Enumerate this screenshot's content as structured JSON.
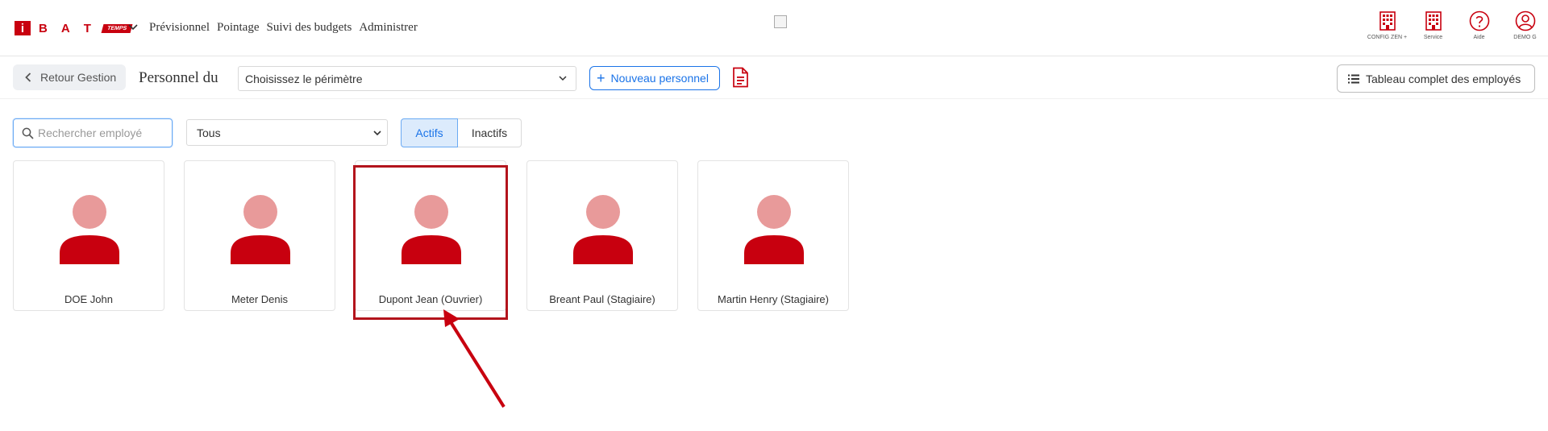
{
  "header": {
    "logo": {
      "mark": "i",
      "letters": [
        "B",
        "A",
        "T"
      ],
      "tag": "TEMPS"
    },
    "nav": [
      "Prévisionnel",
      "Pointage",
      "Suivi des budgets",
      "Administrer"
    ],
    "icons": [
      {
        "name": "building-icon",
        "label": "CONFIG ZEN +"
      },
      {
        "name": "building-icon",
        "label": "Service"
      },
      {
        "name": "help-icon",
        "label": "Aide"
      },
      {
        "name": "user-icon",
        "label": "DEMO G"
      }
    ]
  },
  "toolbar": {
    "back_label": "Retour Gestion",
    "title": "Personnel du",
    "perimeter_placeholder": "Choisissez le périmètre",
    "new_label": "Nouveau personnel",
    "table_label": "Tableau complet des employés"
  },
  "filters": {
    "search_placeholder": "Rechercher employé",
    "type_selected": "Tous",
    "status_options": [
      "Actifs",
      "Inactifs"
    ],
    "status_selected": "Actifs"
  },
  "employees": [
    {
      "name": "DOE John"
    },
    {
      "name": "Meter Denis"
    },
    {
      "name": "Dupont Jean (Ouvrier)"
    },
    {
      "name": "Breant Paul (Stagiaire)"
    },
    {
      "name": "Martin Henry (Stagiaire)"
    }
  ],
  "colors": {
    "brand": "#c8000f",
    "avatar_head": "#e89a9a",
    "avatar_body": "#c8000f",
    "accent": "#1a73e8",
    "highlight": "#b3141c"
  }
}
